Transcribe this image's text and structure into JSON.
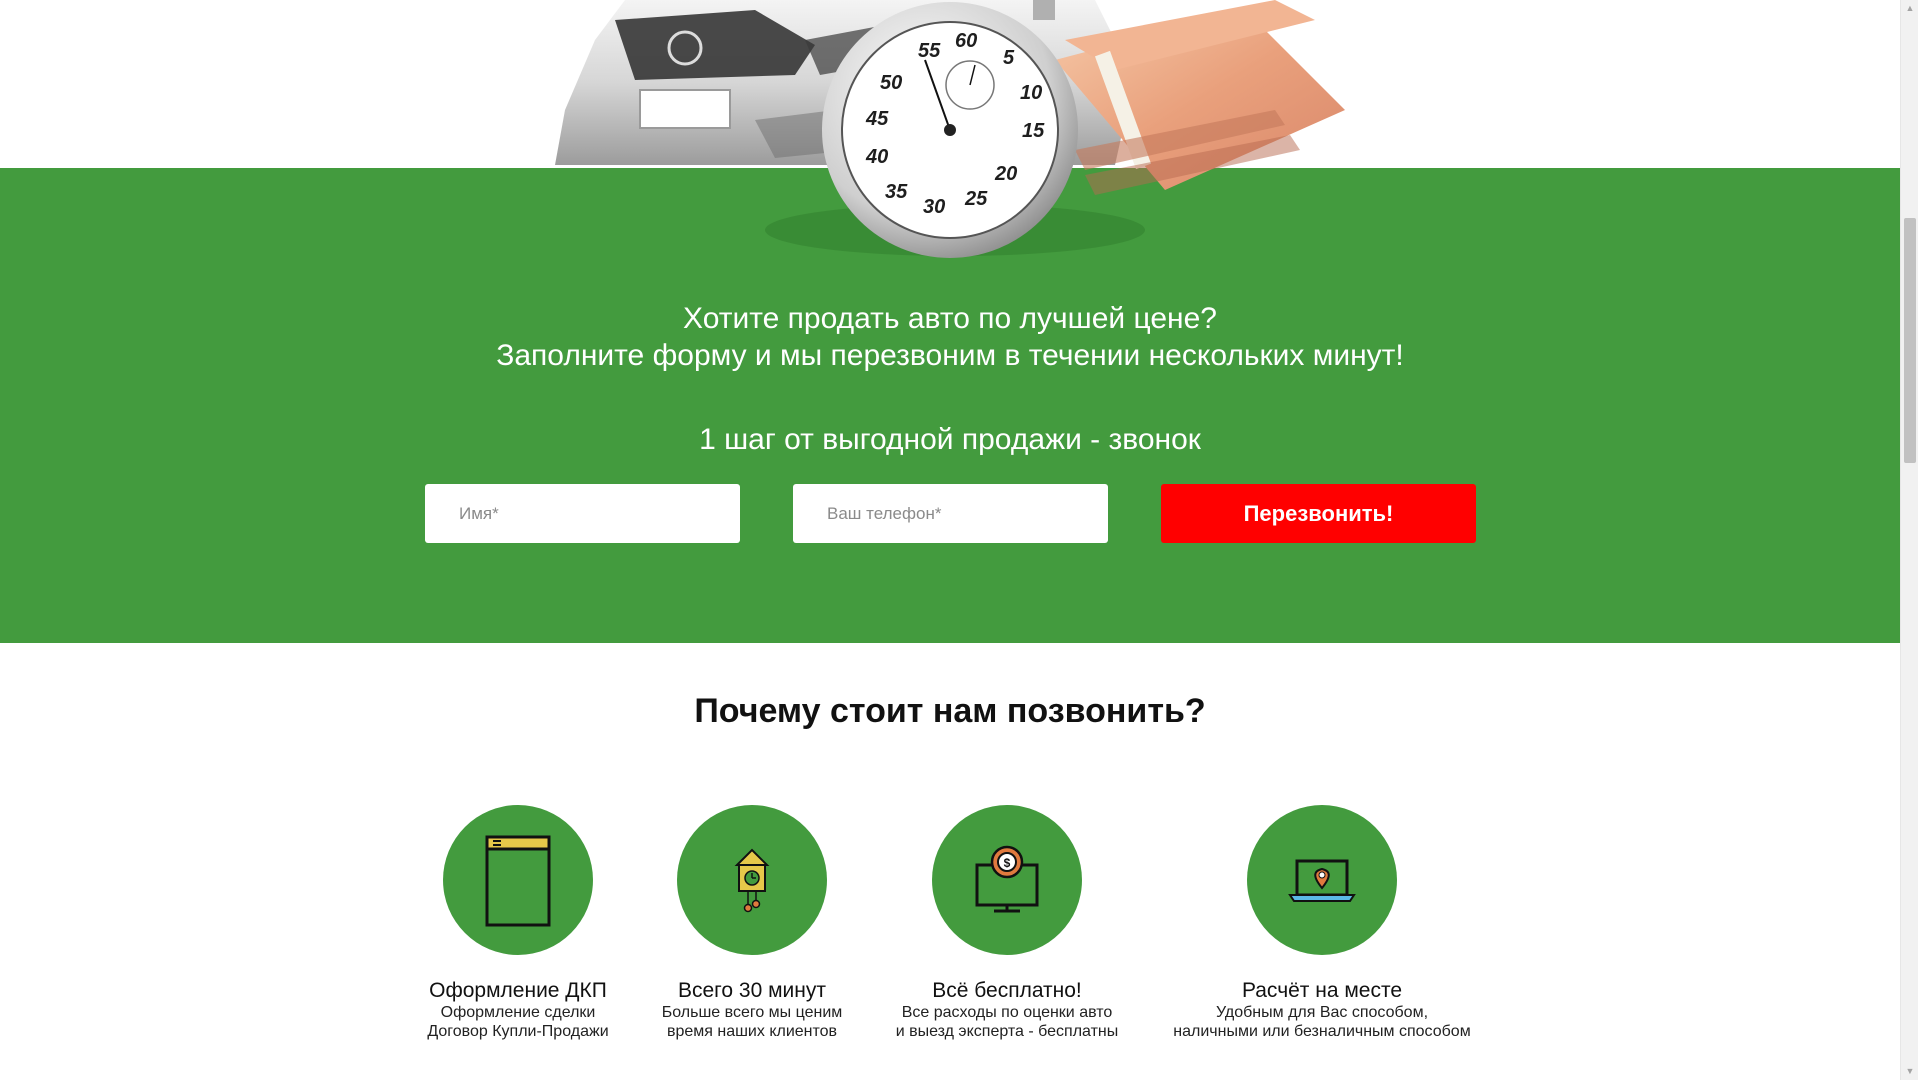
{
  "hero": {
    "headline_line1": "Хотите продать авто по лучшей цене?",
    "headline_line2": "Заполните форму и мы перезвоним в течении нескольких минут!",
    "subheadline": "1 шаг от выгодной продажи - звонок",
    "stopwatch_numbers": [
      "55",
      "60",
      "5",
      "10",
      "15",
      "20",
      "25",
      "30",
      "35",
      "40",
      "45",
      "50"
    ]
  },
  "form": {
    "name_placeholder": "Имя*",
    "phone_placeholder": "Ваш телефон*",
    "submit_label": "Перезвонить!"
  },
  "why": {
    "heading": "Почему стоит нам позвонить?",
    "features": [
      {
        "icon": "document-icon",
        "title": "Оформление ДКП",
        "desc_line1": "Оформление сделки",
        "desc_line2": "Договор Купли-Продажи"
      },
      {
        "icon": "cuckoo-clock-icon",
        "title": "Всего 30 минут",
        "desc_line1": "Больше всего мы ценим",
        "desc_line2": "время наших клиентов"
      },
      {
        "icon": "monitor-money-icon",
        "title": "Всё бесплатно!",
        "desc_line1": "Все расходы по оценки авто",
        "desc_line2": "и выезд эксперта - бесплатны"
      },
      {
        "icon": "laptop-location-icon",
        "title": "Расчёт на месте",
        "desc_line1": "Удобным для Вас способом,",
        "desc_line2": "наличными или безналичным способом"
      }
    ]
  },
  "colors": {
    "green": "#439b3e",
    "cta_red": "#ff0000"
  }
}
